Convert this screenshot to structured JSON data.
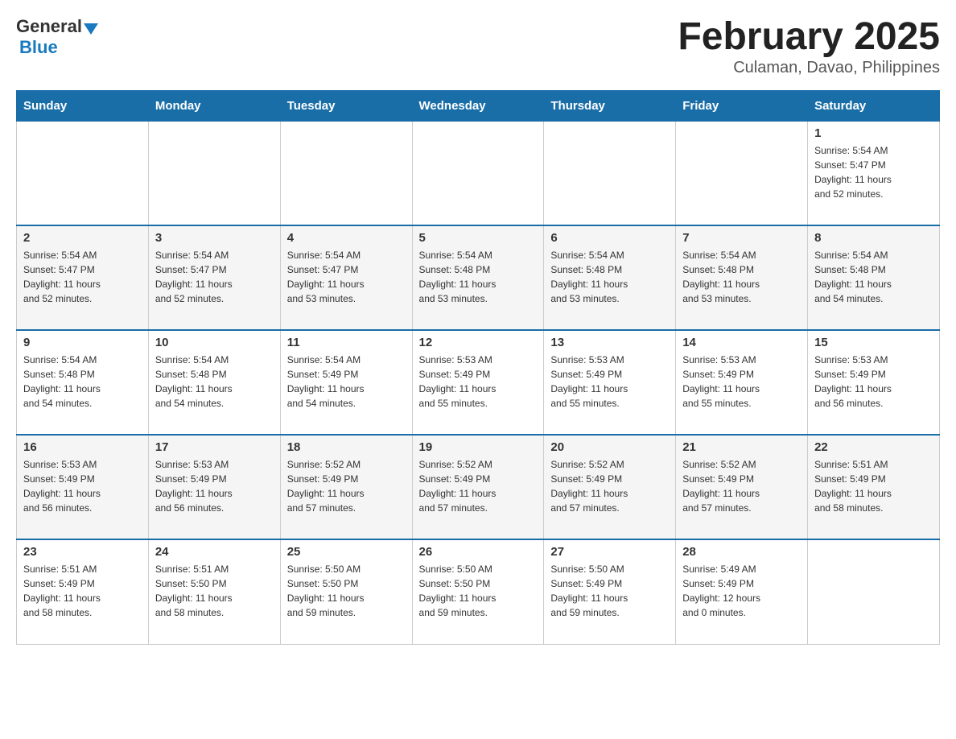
{
  "header": {
    "logo_general": "General",
    "logo_blue": "Blue",
    "title": "February 2025",
    "subtitle": "Culaman, Davao, Philippines"
  },
  "days_of_week": [
    "Sunday",
    "Monday",
    "Tuesday",
    "Wednesday",
    "Thursday",
    "Friday",
    "Saturday"
  ],
  "weeks": [
    [
      {
        "day": "",
        "info": ""
      },
      {
        "day": "",
        "info": ""
      },
      {
        "day": "",
        "info": ""
      },
      {
        "day": "",
        "info": ""
      },
      {
        "day": "",
        "info": ""
      },
      {
        "day": "",
        "info": ""
      },
      {
        "day": "1",
        "info": "Sunrise: 5:54 AM\nSunset: 5:47 PM\nDaylight: 11 hours\nand 52 minutes."
      }
    ],
    [
      {
        "day": "2",
        "info": "Sunrise: 5:54 AM\nSunset: 5:47 PM\nDaylight: 11 hours\nand 52 minutes."
      },
      {
        "day": "3",
        "info": "Sunrise: 5:54 AM\nSunset: 5:47 PM\nDaylight: 11 hours\nand 52 minutes."
      },
      {
        "day": "4",
        "info": "Sunrise: 5:54 AM\nSunset: 5:47 PM\nDaylight: 11 hours\nand 53 minutes."
      },
      {
        "day": "5",
        "info": "Sunrise: 5:54 AM\nSunset: 5:48 PM\nDaylight: 11 hours\nand 53 minutes."
      },
      {
        "day": "6",
        "info": "Sunrise: 5:54 AM\nSunset: 5:48 PM\nDaylight: 11 hours\nand 53 minutes."
      },
      {
        "day": "7",
        "info": "Sunrise: 5:54 AM\nSunset: 5:48 PM\nDaylight: 11 hours\nand 53 minutes."
      },
      {
        "day": "8",
        "info": "Sunrise: 5:54 AM\nSunset: 5:48 PM\nDaylight: 11 hours\nand 54 minutes."
      }
    ],
    [
      {
        "day": "9",
        "info": "Sunrise: 5:54 AM\nSunset: 5:48 PM\nDaylight: 11 hours\nand 54 minutes."
      },
      {
        "day": "10",
        "info": "Sunrise: 5:54 AM\nSunset: 5:48 PM\nDaylight: 11 hours\nand 54 minutes."
      },
      {
        "day": "11",
        "info": "Sunrise: 5:54 AM\nSunset: 5:49 PM\nDaylight: 11 hours\nand 54 minutes."
      },
      {
        "day": "12",
        "info": "Sunrise: 5:53 AM\nSunset: 5:49 PM\nDaylight: 11 hours\nand 55 minutes."
      },
      {
        "day": "13",
        "info": "Sunrise: 5:53 AM\nSunset: 5:49 PM\nDaylight: 11 hours\nand 55 minutes."
      },
      {
        "day": "14",
        "info": "Sunrise: 5:53 AM\nSunset: 5:49 PM\nDaylight: 11 hours\nand 55 minutes."
      },
      {
        "day": "15",
        "info": "Sunrise: 5:53 AM\nSunset: 5:49 PM\nDaylight: 11 hours\nand 56 minutes."
      }
    ],
    [
      {
        "day": "16",
        "info": "Sunrise: 5:53 AM\nSunset: 5:49 PM\nDaylight: 11 hours\nand 56 minutes."
      },
      {
        "day": "17",
        "info": "Sunrise: 5:53 AM\nSunset: 5:49 PM\nDaylight: 11 hours\nand 56 minutes."
      },
      {
        "day": "18",
        "info": "Sunrise: 5:52 AM\nSunset: 5:49 PM\nDaylight: 11 hours\nand 57 minutes."
      },
      {
        "day": "19",
        "info": "Sunrise: 5:52 AM\nSunset: 5:49 PM\nDaylight: 11 hours\nand 57 minutes."
      },
      {
        "day": "20",
        "info": "Sunrise: 5:52 AM\nSunset: 5:49 PM\nDaylight: 11 hours\nand 57 minutes."
      },
      {
        "day": "21",
        "info": "Sunrise: 5:52 AM\nSunset: 5:49 PM\nDaylight: 11 hours\nand 57 minutes."
      },
      {
        "day": "22",
        "info": "Sunrise: 5:51 AM\nSunset: 5:49 PM\nDaylight: 11 hours\nand 58 minutes."
      }
    ],
    [
      {
        "day": "23",
        "info": "Sunrise: 5:51 AM\nSunset: 5:49 PM\nDaylight: 11 hours\nand 58 minutes."
      },
      {
        "day": "24",
        "info": "Sunrise: 5:51 AM\nSunset: 5:50 PM\nDaylight: 11 hours\nand 58 minutes."
      },
      {
        "day": "25",
        "info": "Sunrise: 5:50 AM\nSunset: 5:50 PM\nDaylight: 11 hours\nand 59 minutes."
      },
      {
        "day": "26",
        "info": "Sunrise: 5:50 AM\nSunset: 5:50 PM\nDaylight: 11 hours\nand 59 minutes."
      },
      {
        "day": "27",
        "info": "Sunrise: 5:50 AM\nSunset: 5:49 PM\nDaylight: 11 hours\nand 59 minutes."
      },
      {
        "day": "28",
        "info": "Sunrise: 5:49 AM\nSunset: 5:49 PM\nDaylight: 12 hours\nand 0 minutes."
      },
      {
        "day": "",
        "info": ""
      }
    ]
  ]
}
